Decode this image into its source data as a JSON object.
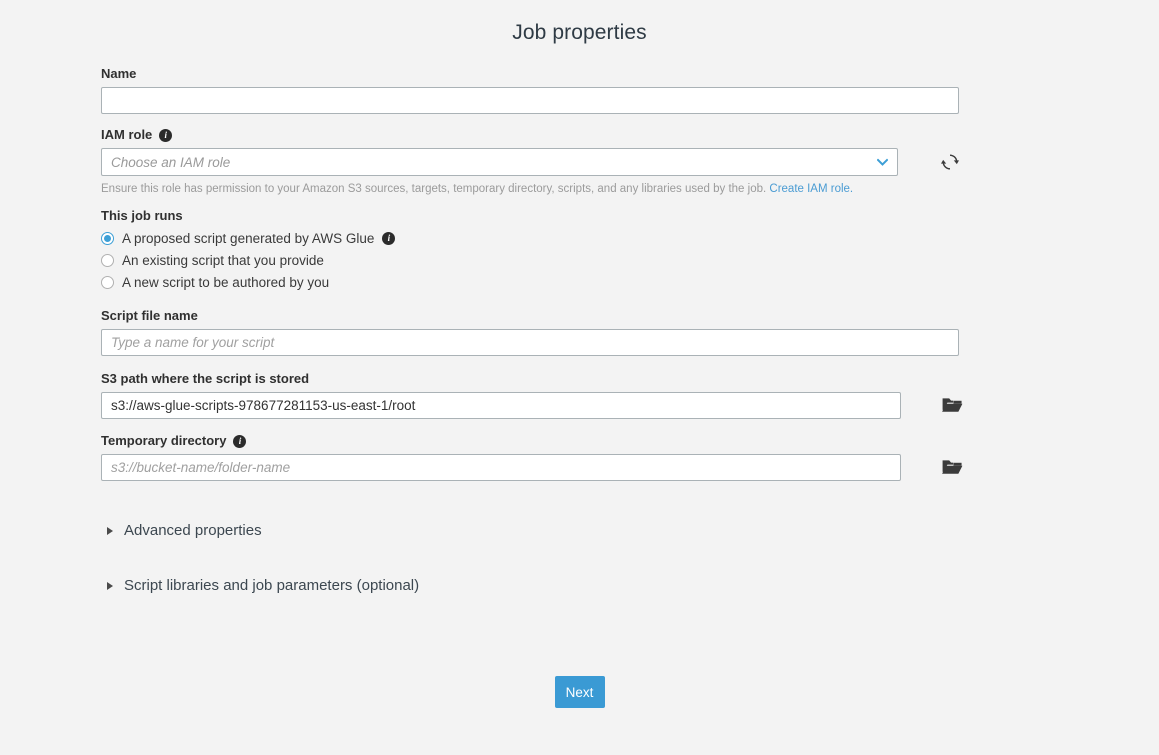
{
  "page": {
    "title": "Job properties",
    "background_color": "#f3f3f3",
    "accent_color": "#3a9ad4"
  },
  "fields": {
    "name": {
      "label": "Name",
      "value": "",
      "placeholder": ""
    },
    "iam_role": {
      "label": "IAM role",
      "info_icon": "info-icon",
      "selected": "Choose an IAM role",
      "chevron_icon": "chevron-down-icon",
      "refresh_icon": "refresh-icon",
      "help_text": "Ensure this role has permission to your Amazon S3 sources, targets, temporary directory, scripts, and any libraries used by the job.",
      "help_link": "Create IAM role."
    },
    "job_runs": {
      "label": "This job runs",
      "options": [
        {
          "label": "A proposed script generated by AWS Glue",
          "selected": true,
          "info_icon": "info-icon"
        },
        {
          "label": "An existing script that you provide",
          "selected": false
        },
        {
          "label": "A new script to be authored by you",
          "selected": false
        }
      ]
    },
    "script_file_name": {
      "label": "Script file name",
      "value": "",
      "placeholder": "Type a name for your script"
    },
    "s3_script_path": {
      "label": "S3 path where the script is stored",
      "value": "s3://aws-glue-scripts-978677281153-us-east-1/root",
      "placeholder": "",
      "browse_icon": "folder-icon"
    },
    "temporary_directory": {
      "label": "Temporary directory",
      "info_icon": "info-icon",
      "value": "",
      "placeholder": "s3://bucket-name/folder-name",
      "browse_icon": "folder-icon"
    }
  },
  "sections": [
    {
      "label": "Advanced properties",
      "expanded": false,
      "icon": "triangle-right-icon"
    },
    {
      "label": "Script libraries and job parameters (optional)",
      "expanded": false,
      "icon": "triangle-right-icon"
    }
  ],
  "footer": {
    "next_label": "Next"
  }
}
